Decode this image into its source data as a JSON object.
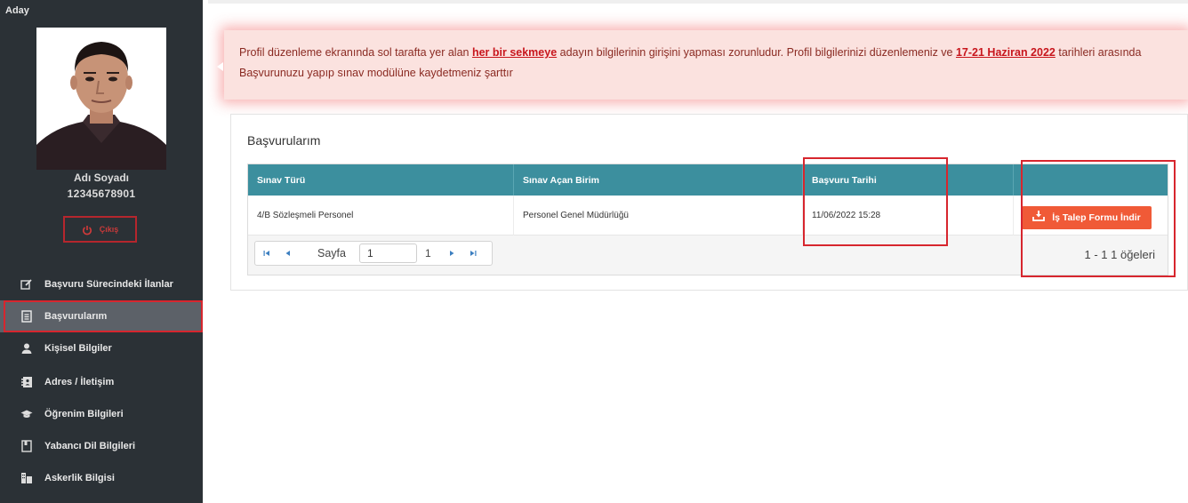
{
  "sidebar": {
    "title": "Aday",
    "user": {
      "name": "Adı Soyadı",
      "id": "12345678901"
    },
    "logout_label": "Çıkış",
    "items": [
      {
        "label": "Başvuru Sürecindeki İlanlar",
        "icon": "edit-icon"
      },
      {
        "label": "Başvurularım",
        "icon": "document-icon"
      },
      {
        "label": "Kişisel Bilgiler",
        "icon": "user-icon"
      },
      {
        "label": "Adres / İletişim",
        "icon": "address-book-icon"
      },
      {
        "label": "Öğrenim Bilgileri",
        "icon": "graduation-cap-icon"
      },
      {
        "label": "Yabancı Dil Bilgileri",
        "icon": "book-icon"
      },
      {
        "label": "Askerlik Bilgisi",
        "icon": "military-icon"
      }
    ],
    "active_index": 1
  },
  "alert": {
    "text_1": "Profil düzenleme ekranında sol tarafta yer alan ",
    "link_1": "her bir sekmeye",
    "text_2": " adayın bilgilerinin girişini yapması zorunludur.  Profil bilgilerinizi düzenlemeniz ve ",
    "link_2": "17-21 Haziran 2022",
    "text_3": " tarihleri arasında Başvurunuzu yapıp sınav modülüne kaydetmeniz şarttır"
  },
  "panel": {
    "title": "Başvurularım",
    "columns": [
      "Sınav Türü",
      "Sınav Açan Birim",
      "Başvuru Tarihi",
      ""
    ],
    "rows": [
      {
        "sinav_turu": "4/B Sözleşmeli Personel",
        "birim": "Personel Genel Müdürlüğü",
        "tarih": "11/06/2022 15:28",
        "action": "İş Talep Formu İndir"
      }
    ],
    "pager": {
      "label": "Sayfa",
      "page": "1",
      "total": "1",
      "info": "1 - 1 1 öğeleri"
    }
  },
  "colors": {
    "sidebar_bg": "#2b3136",
    "header_teal": "#3c8f9e",
    "action_orange": "#f05a37",
    "highlight_red": "#d7262e",
    "alert_bg": "#fbe2df"
  }
}
